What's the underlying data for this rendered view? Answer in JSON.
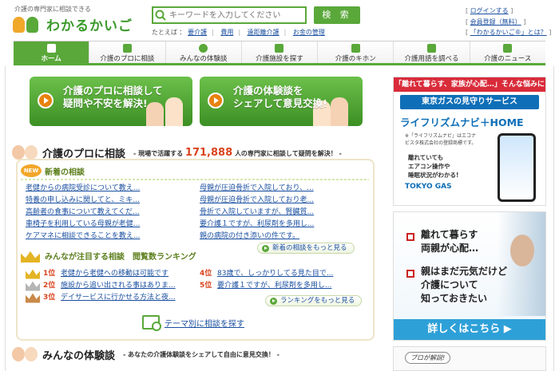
{
  "header": {
    "tagline": "介護の専門家に相談できる",
    "logo_text": "わかるかいご",
    "search_placeholder": "キーワードを入力してください",
    "search_button": "検 索",
    "example_label": "たとえば ：",
    "example_links": [
      "要介護",
      "費用",
      "遠距離介護",
      "お金の管理"
    ],
    "login": "ログインする",
    "register": "会員登録（無料）",
    "about": "「わかるかいご®」とは？"
  },
  "nav": [
    {
      "label": "ホーム",
      "icon": "home-icon",
      "active": true
    },
    {
      "label": "介護のプロに相談",
      "icon": "consult-icon"
    },
    {
      "label": "みんなの体験談",
      "icon": "people-icon"
    },
    {
      "label": "介護施設を探す",
      "icon": "facility-icon"
    },
    {
      "label": "介護のキホン",
      "icon": "book-icon"
    },
    {
      "label": "介護用語を調べる",
      "icon": "dictionary-icon"
    },
    {
      "label": "介護のニュース",
      "icon": "news-icon"
    }
  ],
  "banners": [
    {
      "line1": "介護のプロに相談して",
      "line2": "疑問や不安を解決!"
    },
    {
      "line1": "介護の体験談を",
      "line2": "シェアして意見交換!"
    }
  ],
  "consult": {
    "title": "介護のプロに相談",
    "sub_prefix": "- 現場で活躍する",
    "count": "171,888",
    "sub_suffix": "人の専門家に相談して疑問を解決！ -",
    "new_badge": "NEW",
    "new_title": "新着の相談",
    "new_left": [
      "老健からの病院受診について教え...",
      "特養の申し込みに関してと、ミキ...",
      "高齢者の食事について教えてくだ...",
      "車椅子を利用している母親が老健...",
      "ケアマネに相談できることを教え..."
    ],
    "new_right": [
      "母親が圧迫骨折で入院しており、...",
      "母親が圧迫骨折で入院しており老...",
      "骨折で入院していますが、腎臓質...",
      "要介護１ですが、利尿剤を多用し...",
      "親の病院の付き添いの件です。"
    ],
    "new_more": "新着の相談をもっと見る",
    "rank_title": "みんなが注目する相談　閲覧数ランキング",
    "rank_left": [
      {
        "rank": "1位",
        "text": "老健から老健への移動は可能です"
      },
      {
        "rank": "2位",
        "text": "施設から追い出される事はありま..."
      },
      {
        "rank": "3位",
        "text": "デイサービスに行かせる方法と夜..."
      }
    ],
    "rank_right": [
      {
        "rank": "4位",
        "text": "83歳で、しっかりしてる見た目で..."
      },
      {
        "rank": "5位",
        "text": "要介護１ですが、利尿剤を多用し..."
      }
    ],
    "rank_more": "ランキングをもっと見る",
    "theme_link": "テーマ別に相談を探す"
  },
  "experience": {
    "title": "みんなの体験談",
    "sub": "- あなたの介護体験談をシェアして自由に意見交換！ -"
  },
  "ads": {
    "ad1_top": "「離れて暮らす、家族が心配…」そんな悩みに",
    "ad1_service": "東京ガスの見守りサービス",
    "ad1_brand": "ライフリズムナビ＋HOME",
    "ad1_small": "※「ライフリズムナビ」はエコナビスタ株式会社の登録商標です。",
    "ad1_pitch": [
      "離れていても",
      "エアコン操作や",
      "睡眠状況がわかる!"
    ],
    "ad1_gas": "TOKYO GAS",
    "ad2_lines": [
      "離れて暮らす",
      "両親が心配…",
      "親はまだ元気だけど",
      "介護について",
      "知っておきたい"
    ],
    "ad2_cta": "詳しくはこちら ▶",
    "ad3_bubble": "プロが解説!"
  },
  "colors": {
    "brand_green": "#5aa83a",
    "accent_red": "#d9441e",
    "link_blue": "#1a4fa0"
  }
}
